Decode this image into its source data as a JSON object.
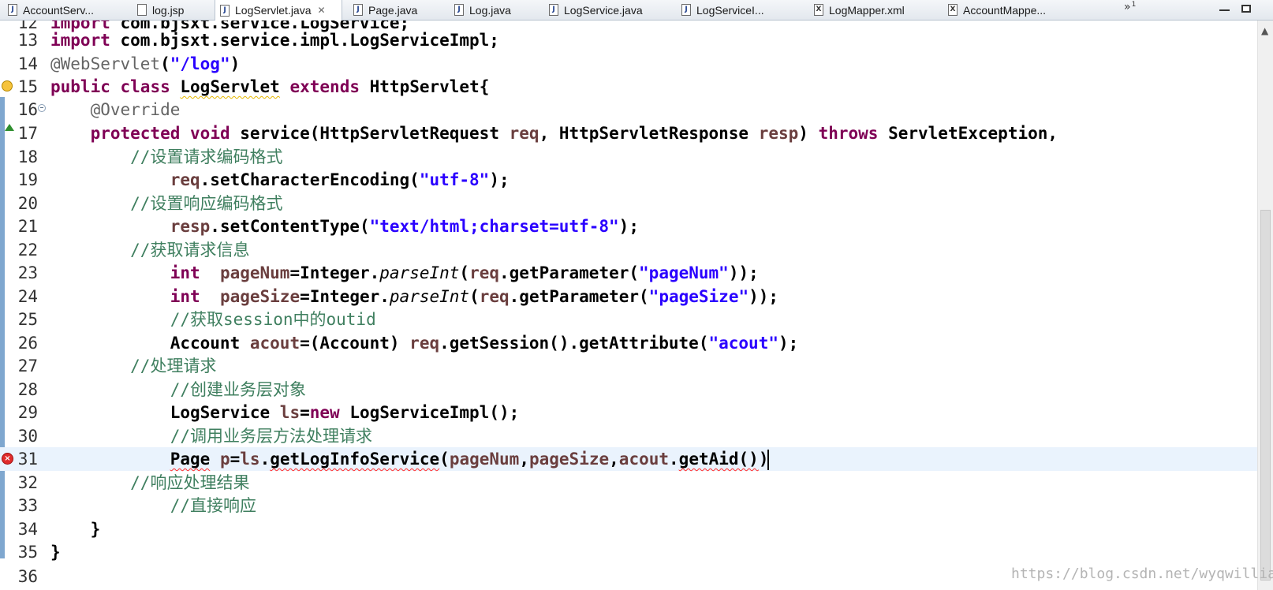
{
  "tabs": [
    {
      "label": "AccountServ...",
      "icon": "java-file-icon",
      "active": false
    },
    {
      "label": "log.jsp",
      "icon": "jsp-file-icon",
      "active": false
    },
    {
      "label": "LogServlet.java",
      "icon": "java-file-icon",
      "active": true
    },
    {
      "label": "Page.java",
      "icon": "java-file-icon",
      "active": false
    },
    {
      "label": "Log.java",
      "icon": "java-file-icon",
      "active": false
    },
    {
      "label": "LogService.java",
      "icon": "java-file-icon",
      "active": false
    },
    {
      "label": "LogServiceI...",
      "icon": "java-file-icon",
      "active": false
    },
    {
      "label": "LogMapper.xml",
      "icon": "xml-file-icon",
      "active": false
    },
    {
      "label": "AccountMappe...",
      "icon": "xml-file-icon",
      "active": false
    }
  ],
  "tab_overflow": {
    "symbol": "»",
    "count": "1"
  },
  "close_glyph": "✕",
  "editor": {
    "lines": [
      {
        "num": "12",
        "text": "import com.bjsxt.service.LogService;"
      },
      {
        "num": "13",
        "text": "import com.bjsxt.service.impl.LogServiceImpl;"
      },
      {
        "num": "14",
        "text": "@WebServlet(\"/log\")"
      },
      {
        "num": "15",
        "text": "public class LogServlet extends HttpServlet{",
        "marker": "warning"
      },
      {
        "num": "16",
        "text": "    @Override",
        "fold": true
      },
      {
        "num": "17",
        "text": "    protected void service(HttpServletRequest req, HttpServletResponse resp) throws ServletException,",
        "marker": "override"
      },
      {
        "num": "18",
        "text": "        //设置请求编码格式"
      },
      {
        "num": "19",
        "text": "            req.setCharacterEncoding(\"utf-8\");"
      },
      {
        "num": "20",
        "text": "        //设置响应编码格式"
      },
      {
        "num": "21",
        "text": "            resp.setContentType(\"text/html;charset=utf-8\");"
      },
      {
        "num": "22",
        "text": "        //获取请求信息"
      },
      {
        "num": "23",
        "text": "            int  pageNum=Integer.parseInt(req.getParameter(\"pageNum\"));"
      },
      {
        "num": "24",
        "text": "            int  pageSize=Integer.parseInt(req.getParameter(\"pageSize\"));"
      },
      {
        "num": "25",
        "text": "            //获取session中的outid"
      },
      {
        "num": "26",
        "text": "            Account acout=(Account) req.getSession().getAttribute(\"acout\");"
      },
      {
        "num": "27",
        "text": "        //处理请求"
      },
      {
        "num": "28",
        "text": "            //创建业务层对象"
      },
      {
        "num": "29",
        "text": "            LogService ls=new LogServiceImpl();"
      },
      {
        "num": "30",
        "text": "            //调用业务层方法处理请求"
      },
      {
        "num": "31",
        "text": "            Page p=ls.getLogInfoService(pageNum,pageSize,acout.getAid())",
        "marker": "error",
        "current": true
      },
      {
        "num": "32",
        "text": "        //响应处理结果"
      },
      {
        "num": "33",
        "text": "            //直接响应"
      },
      {
        "num": "34",
        "text": "    }"
      },
      {
        "num": "35",
        "text": "}"
      },
      {
        "num": "36",
        "text": ""
      }
    ]
  },
  "watermark": "https://blog.csdn.net/wyqwilliam"
}
